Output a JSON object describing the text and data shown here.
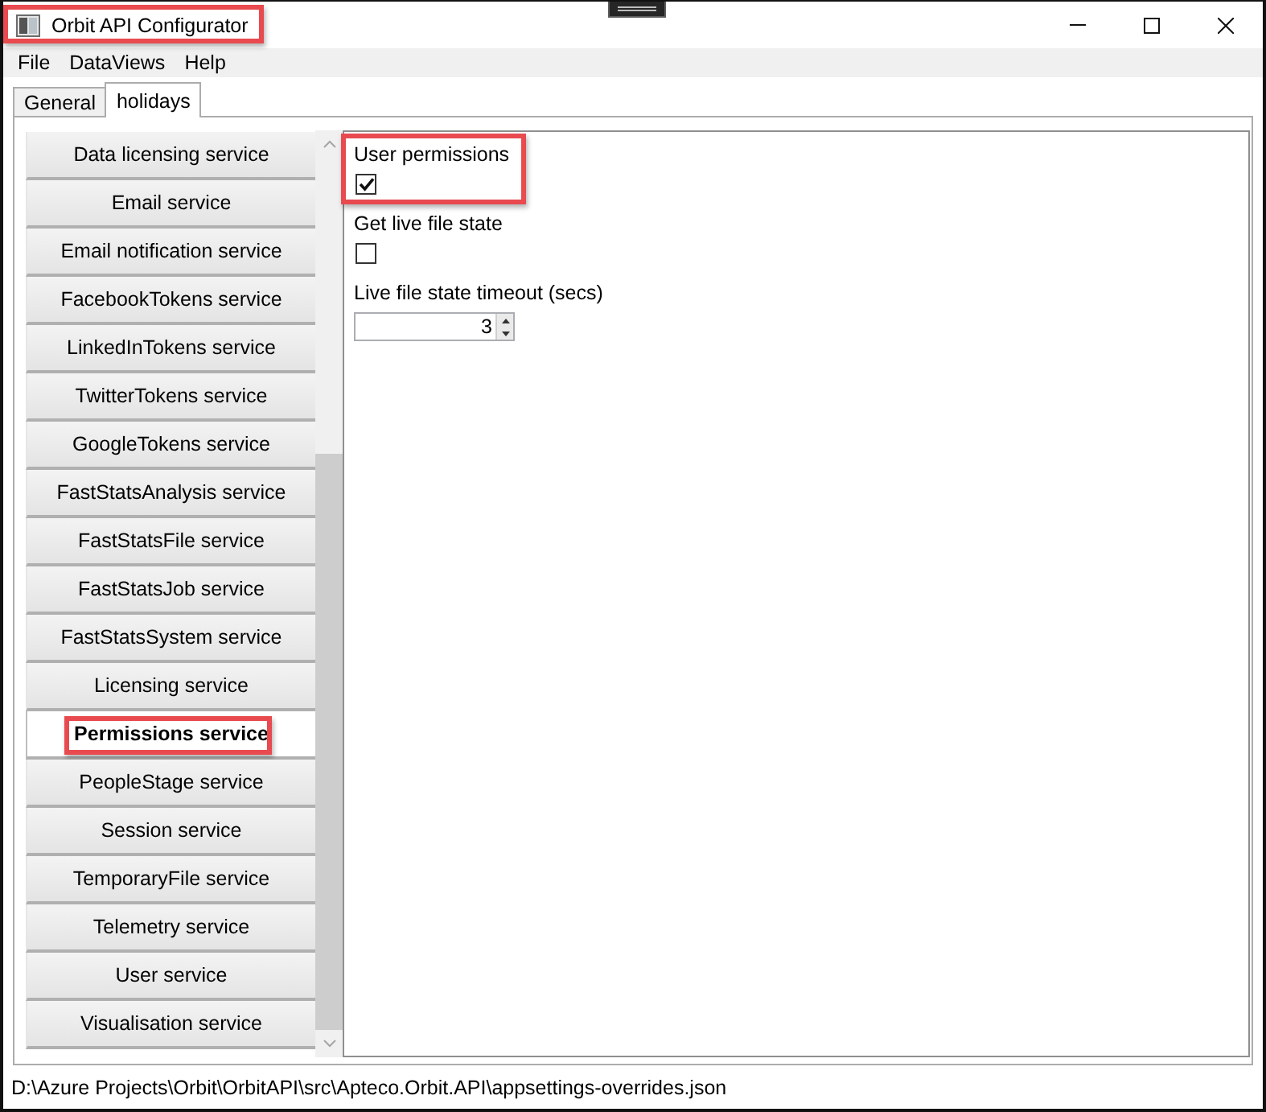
{
  "window": {
    "title": "Orbit API Configurator",
    "highlighted": true
  },
  "menu": [
    "File",
    "DataViews",
    "Help"
  ],
  "tabs": [
    {
      "label": "General",
      "selected": false
    },
    {
      "label": "holidays",
      "selected": true
    }
  ],
  "services": [
    {
      "label": "Data licensing service",
      "selected": false,
      "highlighted": false
    },
    {
      "label": "Email service",
      "selected": false,
      "highlighted": false
    },
    {
      "label": "Email notification service",
      "selected": false,
      "highlighted": false
    },
    {
      "label": "FacebookTokens service",
      "selected": false,
      "highlighted": false
    },
    {
      "label": "LinkedInTokens service",
      "selected": false,
      "highlighted": false
    },
    {
      "label": "TwitterTokens service",
      "selected": false,
      "highlighted": false
    },
    {
      "label": "GoogleTokens service",
      "selected": false,
      "highlighted": false
    },
    {
      "label": "FastStatsAnalysis service",
      "selected": false,
      "highlighted": false
    },
    {
      "label": "FastStatsFile service",
      "selected": false,
      "highlighted": false
    },
    {
      "label": "FastStatsJob service",
      "selected": false,
      "highlighted": false
    },
    {
      "label": "FastStatsSystem service",
      "selected": false,
      "highlighted": false
    },
    {
      "label": "Licensing service",
      "selected": false,
      "highlighted": false
    },
    {
      "label": "Permissions service",
      "selected": true,
      "highlighted": true
    },
    {
      "label": "PeopleStage service",
      "selected": false,
      "highlighted": false
    },
    {
      "label": "Session service",
      "selected": false,
      "highlighted": false
    },
    {
      "label": "TemporaryFile service",
      "selected": false,
      "highlighted": false
    },
    {
      "label": "Telemetry service",
      "selected": false,
      "highlighted": false
    },
    {
      "label": "User service",
      "selected": false,
      "highlighted": false
    },
    {
      "label": "Visualisation service",
      "selected": false,
      "highlighted": false
    }
  ],
  "settings": [
    {
      "kind": "checkbox",
      "label": "User permissions",
      "checked": true,
      "highlighted": true
    },
    {
      "kind": "checkbox",
      "label": "Get live file state",
      "checked": false,
      "highlighted": false
    },
    {
      "kind": "number",
      "label": "Live file state timeout (secs)",
      "value": "3",
      "highlighted": false
    }
  ],
  "status_bar": {
    "path": "D:\\Azure Projects\\Orbit\\OrbitAPI\\src\\Apteco.Orbit.API\\appsettings-overrides.json"
  }
}
